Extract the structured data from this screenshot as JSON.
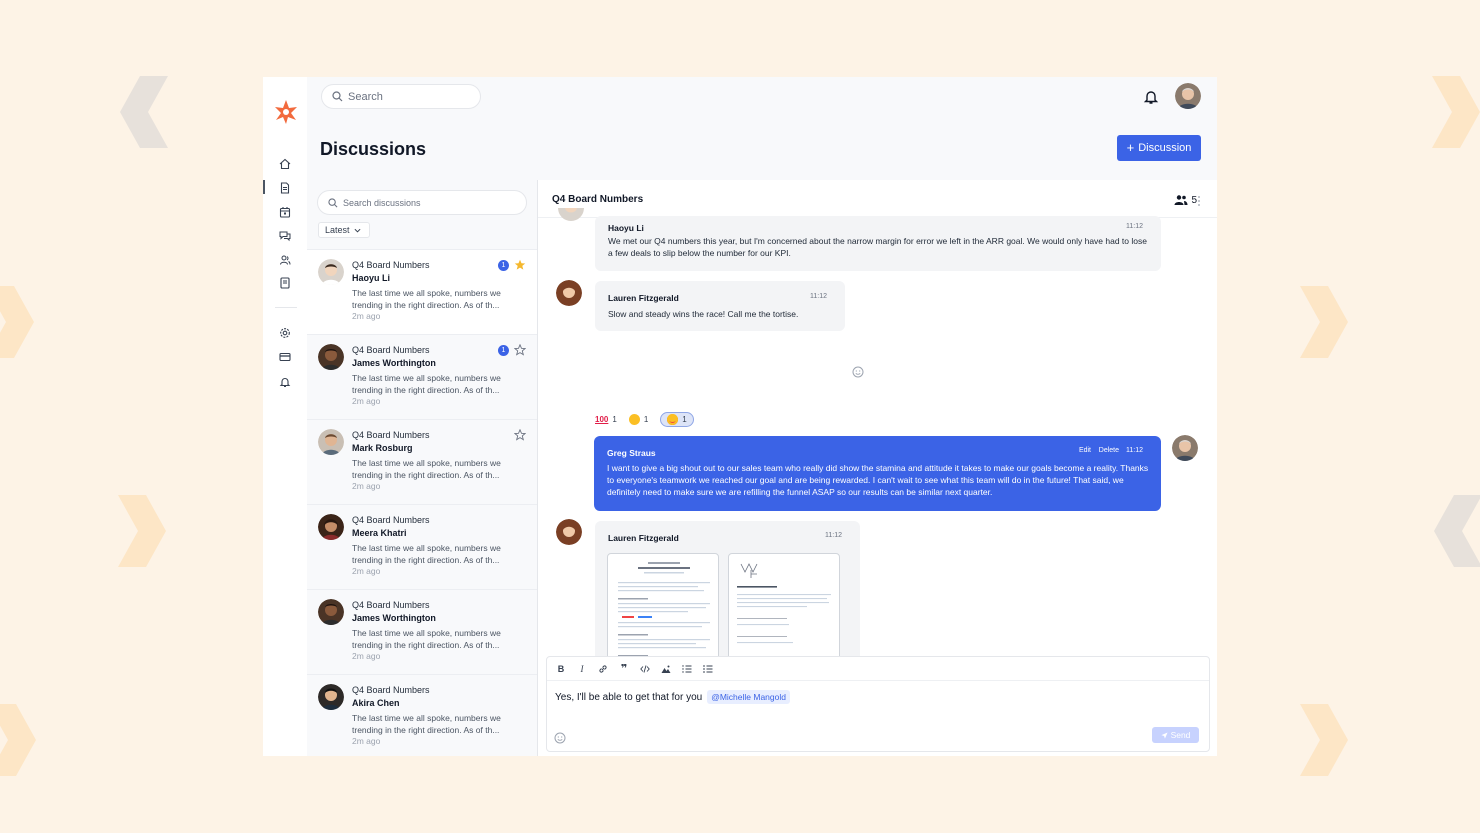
{
  "app": {
    "search_placeholder": "Search",
    "page_title": "Discussions",
    "new_button_label": "Discussion",
    "accent_color": "#3b63e6",
    "brand_color": "#f26a3d"
  },
  "list": {
    "search_placeholder": "Search discussions",
    "sort_label": "Latest",
    "items": [
      {
        "title": "Q4 Board Numbers",
        "name": "Haoyu Li",
        "preview": "The last time we all spoke, numbers we trending in the right direction. As of th...",
        "time": "2m ago",
        "unread": "1",
        "starred": true
      },
      {
        "title": "Q4 Board Numbers",
        "name": "James Worthington",
        "preview": "The last time we all spoke, numbers we trending in the right direction. As of th...",
        "time": "2m ago",
        "unread": "1",
        "starred": false
      },
      {
        "title": "Q4 Board Numbers",
        "name": "Mark Rosburg",
        "preview": "The last time we all spoke, numbers we trending in the right direction. As of th...",
        "time": "2m ago",
        "starred": false
      },
      {
        "title": "Q4 Board Numbers",
        "name": "Meera Khatri",
        "preview": "The last time we all spoke, numbers we trending in the right direction. As of th...",
        "time": "2m ago"
      },
      {
        "title": "Q4 Board Numbers",
        "name": "James Worthington",
        "preview": "The last time we all spoke, numbers we trending in the right direction. As of th...",
        "time": "2m ago"
      },
      {
        "title": "Q4 Board Numbers",
        "name": "Akira Chen",
        "preview": "The last time we all spoke, numbers we trending in the right direction. As of th...",
        "time": "2m ago"
      }
    ]
  },
  "chat": {
    "title": "Q4 Board Numbers",
    "member_count": "5",
    "messages": [
      {
        "author": "Haoyu Li",
        "time": "11:12",
        "line1": "We met our Q4 numbers this year, but I'm concerned about the narrow margin for error we left in the ARR goal. We would only have had to lose",
        "line2": "a few deals to slip below the number for our KPI."
      },
      {
        "author": "Lauren Fitzgerald",
        "time": "11:12",
        "line1": "Slow and steady wins the race! Call me the tortise."
      },
      {
        "author": "Greg Straus",
        "time": "11:12",
        "edit_label": "Edit",
        "delete_label": "Delete",
        "line1": "I want to give a big shout out to our sales team who really did show the stamina and attitude it takes to make our goals become a reality. Thanks",
        "line2": "to everyone's teamwork we reached our goal and are being rewarded. I can't wait to see what this team will do in the future! That said, we",
        "line3": "definitely need to make sure we are refilling the funnel ASAP so our results can be similar next quarter."
      },
      {
        "author": "Lauren Fitzgerald",
        "time": "11:12"
      }
    ],
    "reactions": [
      {
        "emoji": "100",
        "count": "1"
      },
      {
        "emoji": "grinning",
        "count": "1"
      },
      {
        "emoji": "heart-eyes",
        "count": "1"
      }
    ]
  },
  "composer": {
    "text": "Yes, I'll be able to get that for you",
    "mention": "@Michelle Mangold",
    "send_label": "Send"
  }
}
